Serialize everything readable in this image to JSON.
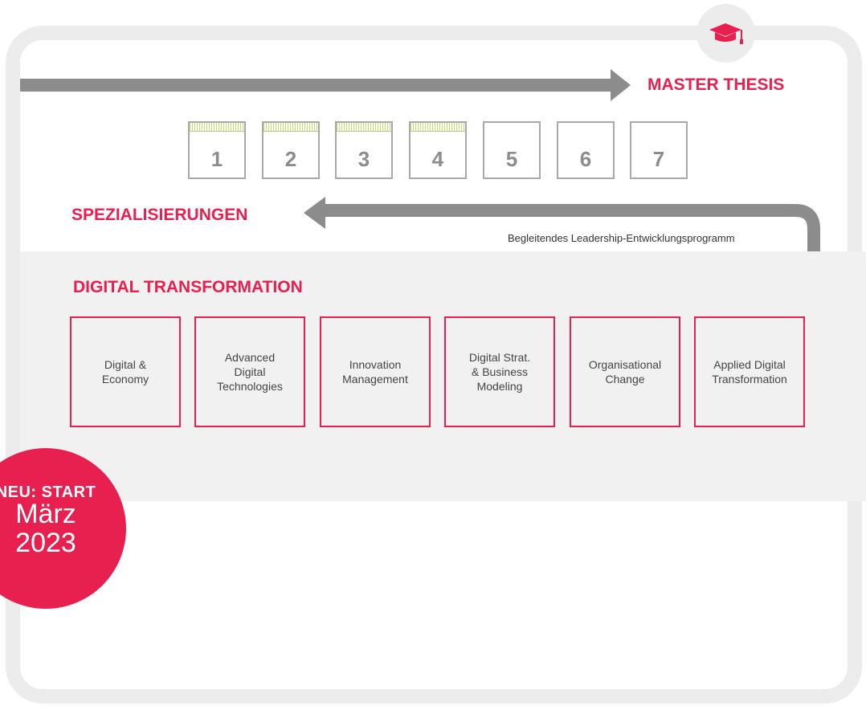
{
  "header": {
    "master_thesis": "MASTER THESIS",
    "specializations": "SPEZIALISIERUNGEN",
    "leadership_program": "Begleitendes Leadership-Entwicklungsprogramm"
  },
  "icon": "graduation-cap-icon",
  "semesters": [
    {
      "number": "1",
      "completed": true
    },
    {
      "number": "2",
      "completed": true
    },
    {
      "number": "3",
      "completed": true
    },
    {
      "number": "4",
      "completed": true
    },
    {
      "number": "5",
      "completed": false
    },
    {
      "number": "6",
      "completed": false
    },
    {
      "number": "7",
      "completed": false
    }
  ],
  "section": {
    "title": "DIGITAL TRANSFORMATION",
    "modules": [
      {
        "label": "Digital &\nEconomy"
      },
      {
        "label": "Advanced\nDigital\nTechnologies"
      },
      {
        "label": "Innovation\nManagement"
      },
      {
        "label": "Digital Strat.\n& Business\nModeling"
      },
      {
        "label": "Organisational\nChange"
      },
      {
        "label": "Applied Digital\nTransformation"
      }
    ]
  },
  "badge": {
    "top": "NEU: START",
    "month": "März",
    "year": "2023"
  },
  "colors": {
    "accent": "#e8204f",
    "arrow": "#8c8c8c",
    "frame": "#ececec",
    "band": "#f1f1f1",
    "hatch": "#c3dd6e"
  }
}
